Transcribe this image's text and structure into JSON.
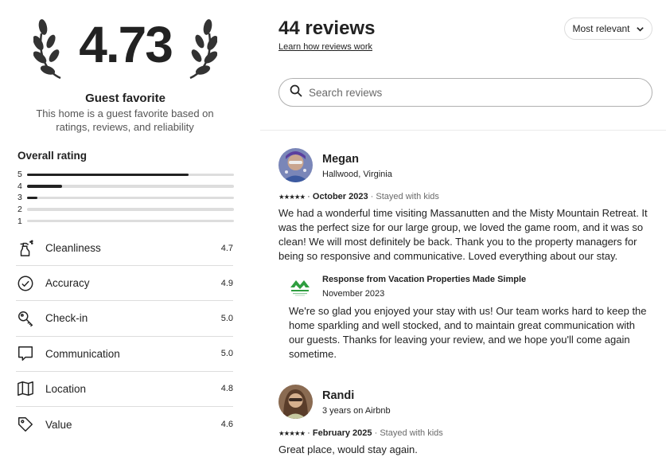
{
  "summary": {
    "score": "4.73",
    "guest_favorite_title": "Guest favorite",
    "guest_favorite_desc": "This home is a guest favorite based on ratings, reviews, and reliability",
    "overall_label": "Overall rating",
    "distribution": [
      {
        "stars": "5",
        "fraction": 0.78
      },
      {
        "stars": "4",
        "fraction": 0.17
      },
      {
        "stars": "3",
        "fraction": 0.05
      },
      {
        "stars": "2",
        "fraction": 0.0
      },
      {
        "stars": "1",
        "fraction": 0.0
      }
    ],
    "categories": [
      {
        "label": "Cleanliness",
        "value": "4.7",
        "icon": "spray-bottle-icon"
      },
      {
        "label": "Accuracy",
        "value": "4.9",
        "icon": "check-circle-icon"
      },
      {
        "label": "Check-in",
        "value": "5.0",
        "icon": "key-icon"
      },
      {
        "label": "Communication",
        "value": "5.0",
        "icon": "chat-bubble-icon"
      },
      {
        "label": "Location",
        "value": "4.8",
        "icon": "map-icon"
      },
      {
        "label": "Value",
        "value": "4.6",
        "icon": "tag-icon"
      }
    ]
  },
  "reviews_header": {
    "title": "44 reviews",
    "learn_link": "Learn how reviews work",
    "sort_label": "Most relevant",
    "search_placeholder": "Search reviews"
  },
  "reviews": [
    {
      "name": "Megan",
      "sub": "Hallwood, Virginia",
      "stars": "★★★★★",
      "date": "October 2023",
      "trip": "Stayed with kids",
      "text": "We had a wonderful time visiting Massanutten and the Misty Mountain Retreat. It was the perfect size for our large group, we loved the game room, and it was so clean! We will most definitely be back. Thank you to the property managers for being so responsive and communicative. Loved everything about our stay.",
      "response": {
        "title": "Response from Vacation Properties Made Simple",
        "date": "November 2023",
        "text": "We're so glad you enjoyed your stay with us! Our team works hard to keep the home sparkling and well stocked, and to maintain great communication with our guests. Thanks for leaving your review, and we hope you'll come again sometime."
      }
    },
    {
      "name": "Randi",
      "sub": "3 years on Airbnb",
      "stars": "★★★★★",
      "date": "February 2025",
      "trip": "Stayed with kids",
      "text": "Great place, would stay again."
    }
  ],
  "colors": {
    "text": "#222222",
    "muted": "#6a6a6a",
    "bar_track": "#dddddd",
    "host_logo_green": "#2e9e3f"
  }
}
